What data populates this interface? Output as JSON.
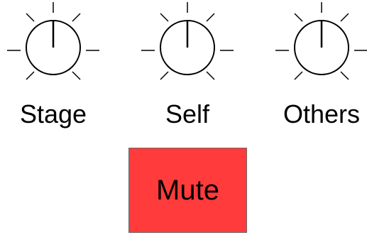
{
  "knobs": [
    {
      "id": "stage",
      "label": "Stage",
      "value": 0.5
    },
    {
      "id": "self",
      "label": "Self",
      "value": 0.5
    },
    {
      "id": "others",
      "label": "Others",
      "value": 0.5
    }
  ],
  "mute": {
    "label": "Mute",
    "color": "#ff3b3b"
  },
  "icons": {
    "knob": "rotary-knob-icon"
  }
}
